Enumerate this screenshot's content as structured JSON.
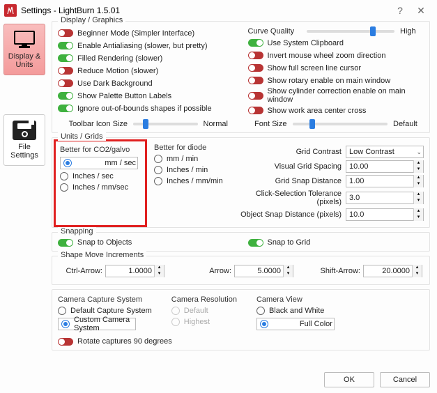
{
  "window": {
    "title": "Settings - LightBurn 1.5.01"
  },
  "sidebar": {
    "display_units": "Display & Units",
    "file_settings": "File Settings"
  },
  "display": {
    "legend": "Display / Graphics",
    "left": [
      {
        "label": "Beginner Mode (Simpler Interface)",
        "on": false
      },
      {
        "label": "Enable Antialiasing (slower, but pretty)",
        "on": true
      },
      {
        "label": "Filled Rendering (slower)",
        "on": true
      },
      {
        "label": "Reduce Motion (slower)",
        "on": false
      },
      {
        "label": "Use Dark Background",
        "on": false
      },
      {
        "label": "Show Palette Button Labels",
        "on": true
      },
      {
        "label": "Ignore out-of-bounds shapes if possible",
        "on": true
      }
    ],
    "right": [
      {
        "label": "Use System Clipboard",
        "on": true
      },
      {
        "label": "Invert mouse wheel zoom direction",
        "on": false
      },
      {
        "label": "Show full screen line cursor",
        "on": false
      },
      {
        "label": "Show rotary enable on main window",
        "on": false
      },
      {
        "label": "Show cylinder correction enable on main window",
        "on": false
      },
      {
        "label": "Show work area center cross",
        "on": false
      }
    ],
    "curve_quality": "Curve Quality",
    "curve_high": "High",
    "toolbar_icon": "Toolbar Icon Size",
    "toolbar_val": "Normal",
    "font_size": "Font Size",
    "font_val": "Default"
  },
  "units": {
    "legend": "Units / Grids",
    "better_co2": "Better for CO2/galvo",
    "better_diode": "Better for diode",
    "co2": [
      "mm / sec",
      "Inches / sec",
      "Inches / mm/sec"
    ],
    "diode": [
      "mm / min",
      "Inches / min",
      "Inches / mm/min"
    ],
    "grid_contrast_lbl": "Grid Contrast",
    "grid_contrast_val": "Low Contrast",
    "vgs_lbl": "Visual Grid Spacing",
    "vgs": "10.00",
    "gsd_lbl": "Grid Snap Distance",
    "gsd": "1.00",
    "cst_lbl": "Click-Selection Tolerance (pixels)",
    "cst": "3.0",
    "osd_lbl": "Object Snap Distance (pixels)",
    "osd": "10.0"
  },
  "snapping": {
    "legend": "Snapping",
    "snap_obj": "Snap to Objects",
    "snap_grid": "Snap to Grid"
  },
  "shape": {
    "legend": "Shape Move Increments",
    "ctrl_lbl": "Ctrl-Arrow:",
    "ctrl": "1.0000",
    "arrow_lbl": "Arrow:",
    "arrow": "5.0000",
    "shift_lbl": "Shift-Arrow:",
    "shift": "20.0000"
  },
  "camera": {
    "cap_legend": "Camera Capture System",
    "cap_default": "Default Capture System",
    "cap_custom": "Custom Camera System",
    "res_legend": "Camera Resolution",
    "res_default": "Default",
    "res_highest": "Highest",
    "view_legend": "Camera View",
    "view_bw": "Black and White",
    "view_full": "Full Color",
    "rotate": "Rotate captures 90 degrees"
  },
  "buttons": {
    "ok": "OK",
    "cancel": "Cancel"
  }
}
